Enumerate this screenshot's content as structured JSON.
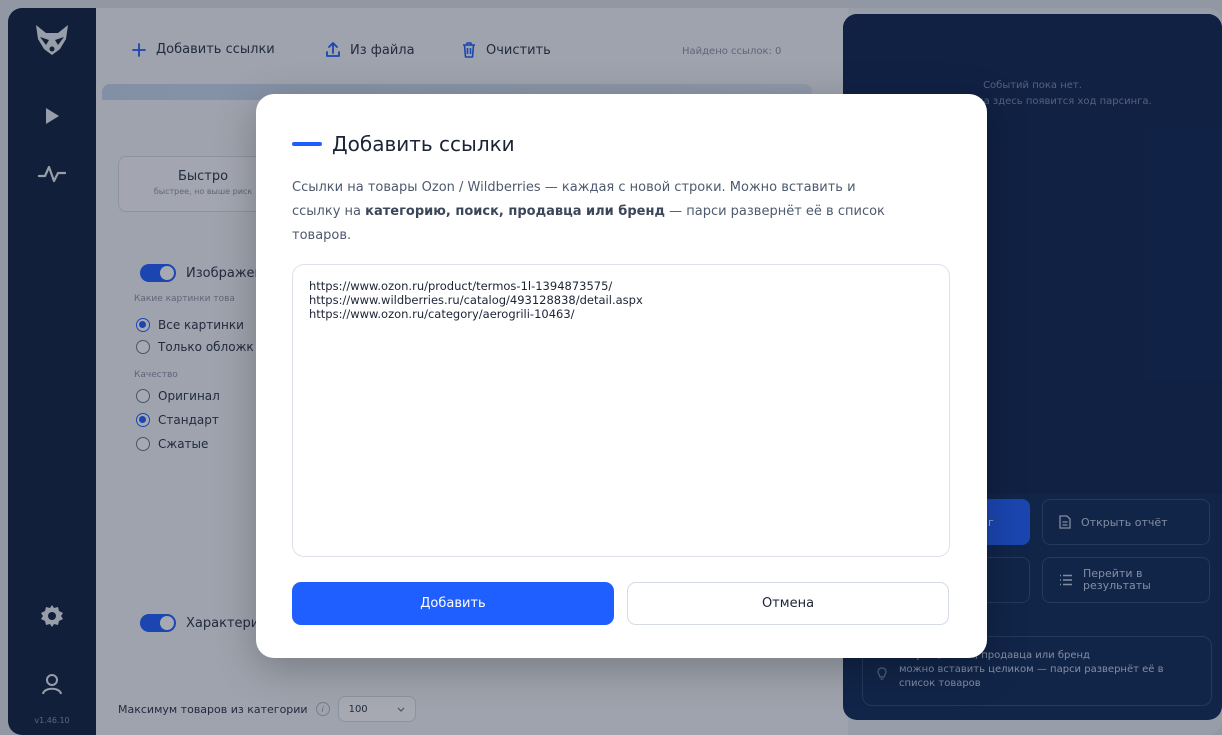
{
  "app": {
    "version": "v1.46.10",
    "accent_color": "#1f5fff",
    "sidebar_color": "#10213f"
  },
  "sidebar": {
    "items": [
      {
        "icon": "raccoon-logo-icon"
      },
      {
        "icon": "play-icon"
      },
      {
        "icon": "activity-icon"
      },
      {
        "icon": "gear-icon"
      },
      {
        "icon": "user-icon"
      }
    ]
  },
  "toolbar": {
    "add_links_label": "Добавить ссылки",
    "from_file_label": "Из файла",
    "clear_label": "Очистить",
    "found_label": "Найдено ссылок: 0"
  },
  "main": {
    "mode_card": {
      "title": "Быстро",
      "subtitle": "быстрее, но выше риск"
    },
    "images_section": {
      "label": "Изображени",
      "which_label": "Какие картинки това",
      "options": [
        "Все картинки",
        "Только обложк"
      ],
      "quality_label": "Качество",
      "quality_options": [
        "Оригинал",
        "Стандарт",
        "Сжатые"
      ]
    },
    "characteristics_label": "Характерис",
    "max_products_label": "Максимум товаров из категории",
    "max_products_value": "100"
  },
  "panel": {
    "empty_title": "Событий пока нет.",
    "empty_sub": "После запуска здесь появится ход парсинга.",
    "start_label": "г",
    "open_report_label": "Открыть отчёт",
    "go_results_label_1": "Перейти в",
    "go_results_label_2": "результаты",
    "hint_line1": "егорию, поиск, продавца или бренд",
    "hint_line2": "можно вставить целиком — парси развернёт её в",
    "hint_line3": "список товаров"
  },
  "modal": {
    "title": "Добавить ссылки",
    "desc_part1": "Ссылки на товары Ozon / Wildberries — каждая с новой строки. Можно вставить и ссылку на ",
    "desc_bold": "категорию, поиск, продавца или бренд",
    "desc_part2": " — парси развернёт её в список товаров.",
    "links_value": "https://www.ozon.ru/product/termos-1l-1394873575/\nhttps://www.wildberries.ru/catalog/493128838/detail.aspx\nhttps://www.ozon.ru/category/aerogrili-10463/",
    "add_button": "Добавить",
    "cancel_button": "Отмена"
  }
}
